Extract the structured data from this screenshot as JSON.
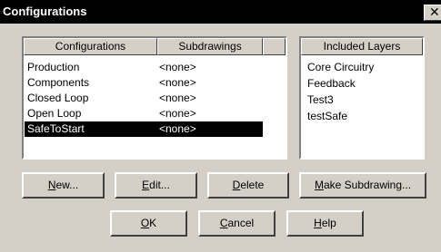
{
  "window": {
    "title": "Configurations",
    "close_glyph": "✕"
  },
  "config_list": {
    "columns": [
      "Configurations",
      "Subdrawings"
    ],
    "rows": [
      {
        "name": "Production",
        "subdrawing": "<none>",
        "selected": false
      },
      {
        "name": "Components",
        "subdrawing": "<none>",
        "selected": false
      },
      {
        "name": "Closed Loop",
        "subdrawing": "<none>",
        "selected": false
      },
      {
        "name": "Open Loop",
        "subdrawing": "<none>",
        "selected": false
      },
      {
        "name": "SafeToStart",
        "subdrawing": "<none>",
        "selected": true
      }
    ]
  },
  "layers_list": {
    "header": "Included Layers",
    "items": [
      "Core Circuitry",
      "Feedback",
      "Test3",
      "testSafe"
    ]
  },
  "buttons": {
    "new": {
      "mnemonic": "N",
      "rest": "ew..."
    },
    "edit": {
      "mnemonic": "E",
      "rest": "dit..."
    },
    "delete": {
      "mnemonic": "D",
      "rest": "elete"
    },
    "make_subdrawing": {
      "mnemonic": "M",
      "rest": "ake Subdrawing..."
    },
    "ok": {
      "mnemonic": "O",
      "rest": "K"
    },
    "cancel": {
      "mnemonic": "C",
      "rest": "ancel"
    },
    "help": {
      "mnemonic": "H",
      "rest": "elp"
    }
  },
  "colors": {
    "face": "#d4d0c8",
    "selection": "#000000",
    "titlebar": "#000000"
  }
}
